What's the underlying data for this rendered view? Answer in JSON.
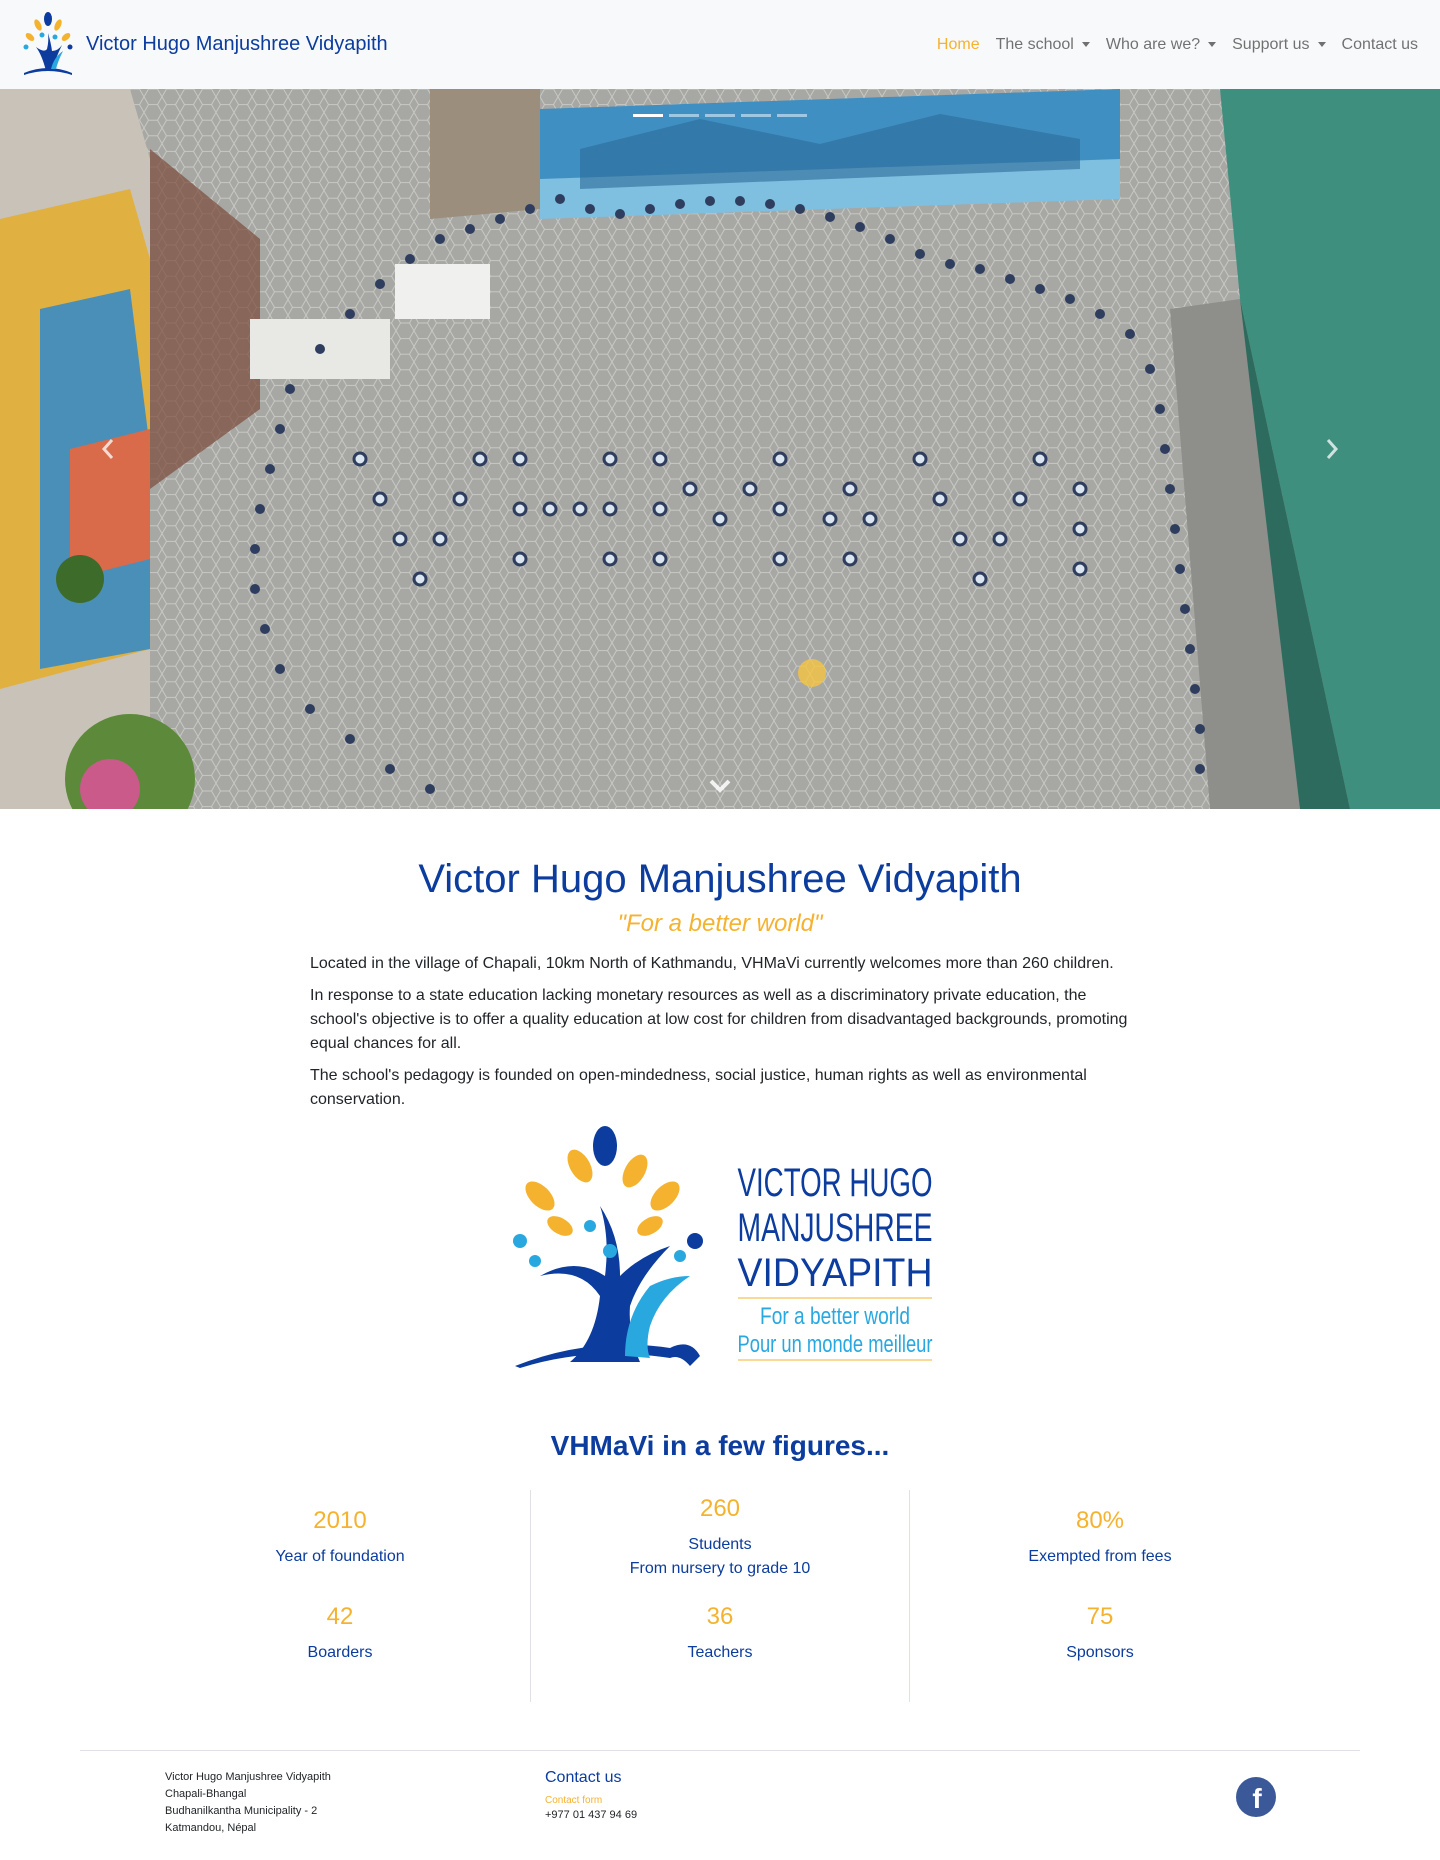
{
  "navbar": {
    "brand": "Victor Hugo Manjushree Vidyapith",
    "items": [
      {
        "label": "Home",
        "active": true,
        "dropdown": false
      },
      {
        "label": "The school",
        "active": false,
        "dropdown": true
      },
      {
        "label": "Who are we?",
        "active": false,
        "dropdown": true
      },
      {
        "label": "Support us",
        "active": false,
        "dropdown": true
      },
      {
        "label": "Contact us",
        "active": false,
        "dropdown": false
      }
    ]
  },
  "carousel": {
    "slide_count": 5,
    "active_slide": 1,
    "image_description": "Aerial photo of students forming the letters VHMaVi in a school courtyard"
  },
  "intro": {
    "title": "Victor Hugo Manjushree Vidyapith",
    "tagline": "\"For a better world\"",
    "paragraphs": [
      "Located in the village of Chapali, 10km North of Kathmandu, VHMaVi currently welcomes more than 260 children.",
      "In response to a state education lacking monetary resources as well as a discriminatory private education, the school's objective is to offer a quality education at low cost for children from disadvantaged backgrounds, promoting equal chances for all.",
      "The school's pedagogy is founded on open-mindedness, social justice, human rights as well as environmental conservation."
    ]
  },
  "logo": {
    "lines": [
      "VICTOR HUGO",
      "MANJUSHREE",
      "VIDYAPITH"
    ],
    "motto_en": "For a better world",
    "motto_fr": "Pour un monde meilleur"
  },
  "figures": {
    "title": "VHMaVi in a few figures...",
    "columns": [
      [
        {
          "value": "2010",
          "label": "Year of foundation",
          "sub": ""
        },
        {
          "value": "42",
          "label": "Boarders",
          "sub": ""
        }
      ],
      [
        {
          "value": "260",
          "label": "Students",
          "sub": "From nursery to grade 10"
        },
        {
          "value": "36",
          "label": "Teachers",
          "sub": ""
        }
      ],
      [
        {
          "value": "80%",
          "label": "Exempted from fees",
          "sub": ""
        },
        {
          "value": "75",
          "label": "Sponsors",
          "sub": ""
        }
      ]
    ]
  },
  "footer": {
    "address": [
      "Victor Hugo Manjushree Vidyapith",
      "Chapali-Bhangal",
      "Budhanilkantha Municipality - 2",
      "Katmandou, Népal"
    ],
    "contact_title": "Contact us",
    "contact_form": "Contact form",
    "phone": "+977 01 437 94 69",
    "social": "facebook-icon"
  },
  "colors": {
    "brand_blue": "#0b3c9e",
    "accent_yellow": "#f5b22f",
    "light_blue": "#29a8e0",
    "navbar_bg": "#f8f9fa"
  }
}
